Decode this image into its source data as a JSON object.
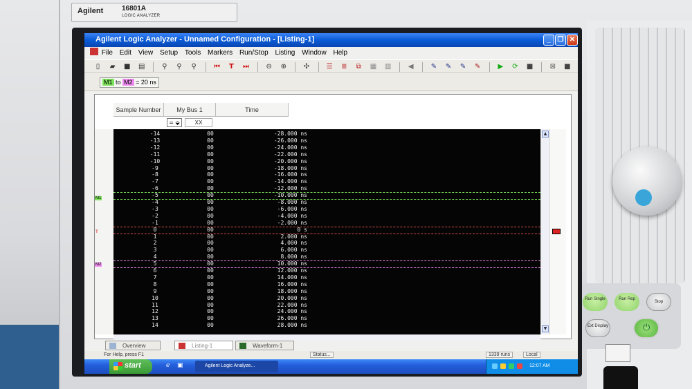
{
  "instrument": {
    "brand": "Agilent",
    "model": "16801A",
    "subtitle": "LOGIC ANALYZER",
    "buttons": {
      "run_single": "Run Single",
      "run_rep": "Run Rep",
      "stop": "Stop",
      "ext_display": "Ext Display"
    }
  },
  "window": {
    "title": "Agilent Logic Analyzer - Unnamed Configuration - [Listing-1]",
    "controls": {
      "minimize": "_",
      "restore": "❐",
      "close": "✕"
    },
    "mdi_controls": {
      "minimize": "_",
      "restore": "▫",
      "close": "×"
    }
  },
  "menu": [
    "File",
    "Edit",
    "View",
    "Setup",
    "Tools",
    "Markers",
    "Run/Stop",
    "Listing",
    "Window",
    "Help"
  ],
  "markerbar": {
    "m1": "M1",
    "to": "to",
    "m2": "M2",
    "value": "= 20 ns"
  },
  "listing": {
    "columns": {
      "sample": "Sample Number",
      "bus": "My Bus 1",
      "time": "Time"
    },
    "filter": {
      "operator": "= ⬙",
      "value": "XX"
    },
    "rows": [
      {
        "s": "-14",
        "b": "00",
        "t": "-28.000 ns"
      },
      {
        "s": "-13",
        "b": "00",
        "t": "-26.000 ns"
      },
      {
        "s": "-12",
        "b": "00",
        "t": "-24.000 ns"
      },
      {
        "s": "-11",
        "b": "00",
        "t": "-22.000 ns"
      },
      {
        "s": "-10",
        "b": "00",
        "t": "-20.000 ns"
      },
      {
        "s": "-9",
        "b": "00",
        "t": "-18.000 ns"
      },
      {
        "s": "-8",
        "b": "00",
        "t": "-16.000 ns"
      },
      {
        "s": "-7",
        "b": "00",
        "t": "-14.000 ns"
      },
      {
        "s": "-6",
        "b": "00",
        "t": "-12.000 ns"
      },
      {
        "s": "-5",
        "b": "00",
        "t": "-10.000 ns"
      },
      {
        "s": "-4",
        "b": "00",
        "t": "-8.000 ns"
      },
      {
        "s": "-3",
        "b": "00",
        "t": "-6.000 ns"
      },
      {
        "s": "-2",
        "b": "00",
        "t": "-4.000 ns"
      },
      {
        "s": "-1",
        "b": "00",
        "t": "-2.000 ns"
      },
      {
        "s": "0",
        "b": "00",
        "t": "0 s"
      },
      {
        "s": "1",
        "b": "00",
        "t": "2.000 ns"
      },
      {
        "s": "2",
        "b": "00",
        "t": "4.000 ns"
      },
      {
        "s": "3",
        "b": "00",
        "t": "6.000 ns"
      },
      {
        "s": "4",
        "b": "00",
        "t": "8.000 ns"
      },
      {
        "s": "5",
        "b": "00",
        "t": "10.000 ns"
      },
      {
        "s": "6",
        "b": "00",
        "t": "12.000 ns"
      },
      {
        "s": "7",
        "b": "00",
        "t": "14.000 ns"
      },
      {
        "s": "8",
        "b": "00",
        "t": "16.000 ns"
      },
      {
        "s": "9",
        "b": "00",
        "t": "18.000 ns"
      },
      {
        "s": "10",
        "b": "00",
        "t": "20.000 ns"
      },
      {
        "s": "11",
        "b": "00",
        "t": "22.000 ns"
      },
      {
        "s": "12",
        "b": "00",
        "t": "24.000 ns"
      },
      {
        "s": "13",
        "b": "00",
        "t": "26.000 ns"
      },
      {
        "s": "14",
        "b": "00",
        "t": "28.000 ns"
      }
    ],
    "gutter_tags": {
      "m1": "M1",
      "trigger": "T",
      "m2": "M2"
    }
  },
  "tabs": [
    "Overview",
    "Listing-1",
    "Waveform-1"
  ],
  "statusbar": {
    "help": "For Help, press F1",
    "status": "Status...",
    "runs": "1339 runs",
    "mode": "Local"
  },
  "taskbar": {
    "start": "start",
    "task": "Agilent Logic Analyze...",
    "clock": "12:07 AM"
  },
  "colors": {
    "m1": "#7ee35c",
    "m2": "#f08cf0",
    "trigger": "#e05050",
    "titlebar": "#0a5bd6"
  }
}
